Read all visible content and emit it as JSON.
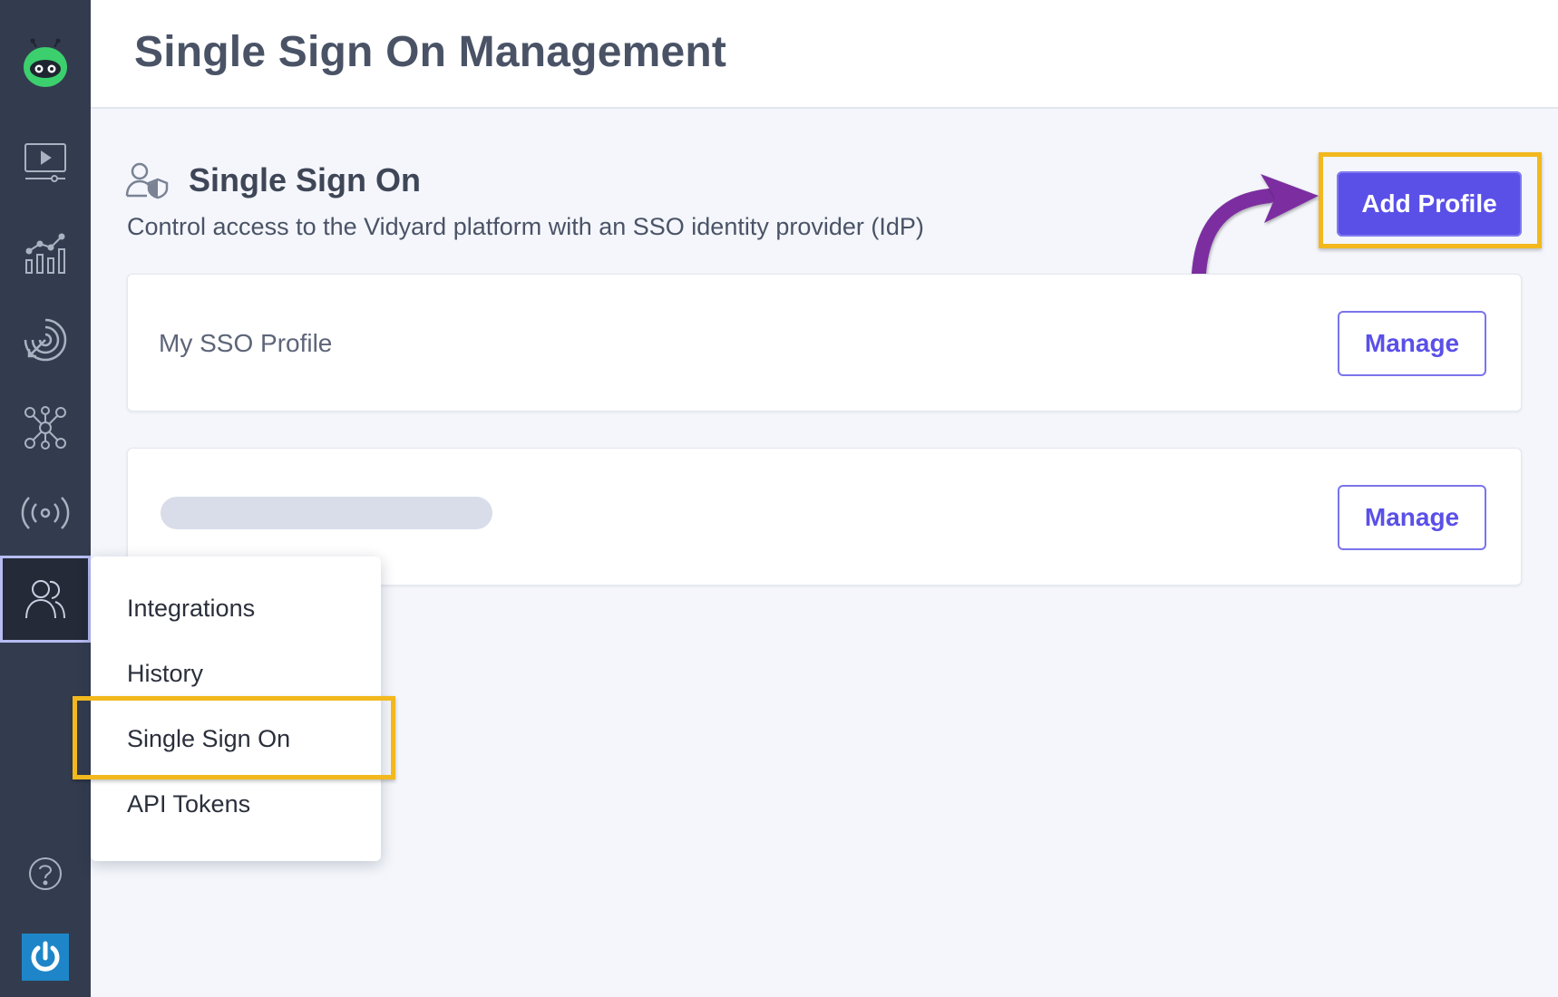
{
  "header": {
    "title": "Single Sign On Management"
  },
  "section": {
    "title": "Single Sign On",
    "description": "Control access to the Vidyard platform with an SSO identity provider (IdP)",
    "icon": "user-shield-icon"
  },
  "add_profile_label": "Add Profile",
  "profiles": [
    {
      "name": "My SSO Profile",
      "action": "Manage"
    },
    {
      "name": "",
      "action": "Manage"
    }
  ],
  "sidebar": {
    "items": [
      {
        "icon": "vidyard-logo-icon"
      },
      {
        "icon": "video-library-icon"
      },
      {
        "icon": "analytics-icon"
      },
      {
        "icon": "target-icon"
      },
      {
        "icon": "hub-network-icon"
      },
      {
        "icon": "broadcast-icon"
      },
      {
        "icon": "team-icon",
        "active": true
      },
      {
        "icon": "help-icon"
      },
      {
        "icon": "power-icon"
      }
    ]
  },
  "menu": {
    "items": [
      "Integrations",
      "History",
      "Single Sign On",
      "API Tokens"
    ],
    "highlighted": "Single Sign On"
  },
  "colors": {
    "accent": "#5a50e8",
    "highlight_box": "#f2b81d",
    "annotation_arrow": "#7b2fa0",
    "sidebar": "#333c4e"
  }
}
